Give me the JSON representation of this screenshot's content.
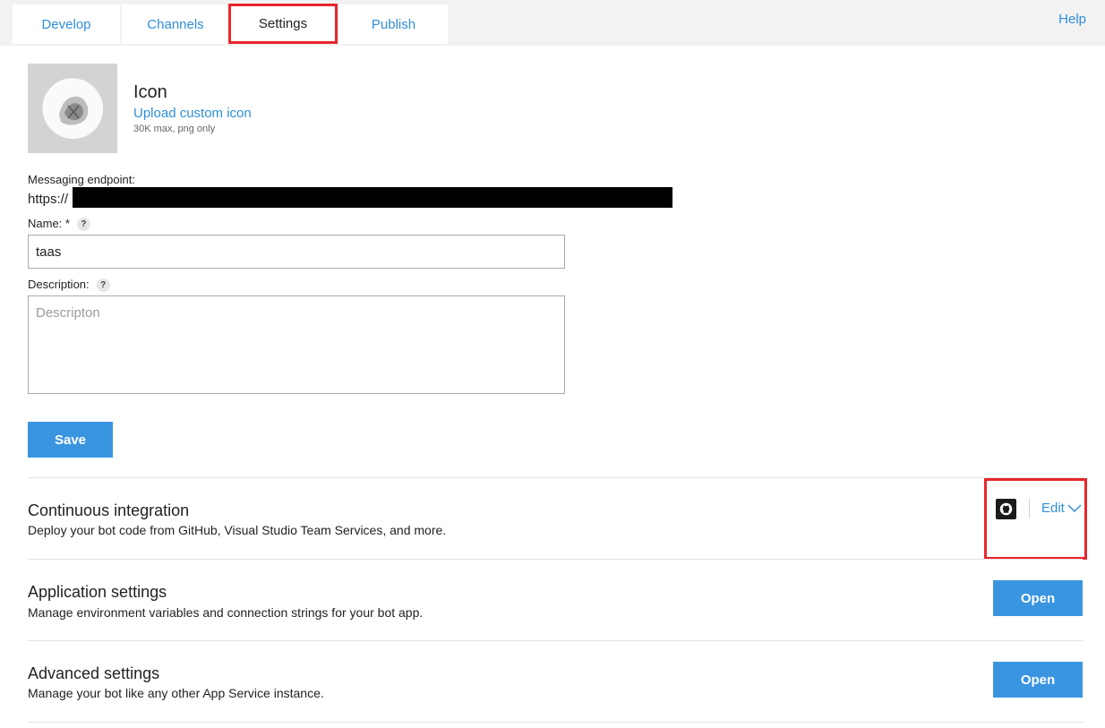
{
  "tabs": [
    "Develop",
    "Channels",
    "Settings",
    "Publish"
  ],
  "active_tab": "Settings",
  "help_link": "Help",
  "icon_section": {
    "title": "Icon",
    "upload_link": "Upload custom icon",
    "note": "30K max, png only"
  },
  "endpoint": {
    "label": "Messaging endpoint:",
    "value_prefix": "https://"
  },
  "name_field": {
    "label": "Name: *",
    "help": "?",
    "value": "taas"
  },
  "description_field": {
    "label": "Description:",
    "help": "?",
    "placeholder": "Descripton"
  },
  "save_label": "Save",
  "continuous_integration": {
    "title": "Continuous integration",
    "description": "Deploy your bot code from GitHub, Visual Studio Team Services, and more.",
    "edit_label": "Edit"
  },
  "application_settings": {
    "title": "Application settings",
    "description": "Manage environment variables and connection strings for your bot app.",
    "button_label": "Open"
  },
  "advanced_settings": {
    "title": "Advanced settings",
    "description": "Manage your bot like any other App Service instance.",
    "button_label": "Open"
  },
  "colors": {
    "accent": "#2f8fd9",
    "button": "#3a95e0",
    "highlight": "#e8262d"
  }
}
